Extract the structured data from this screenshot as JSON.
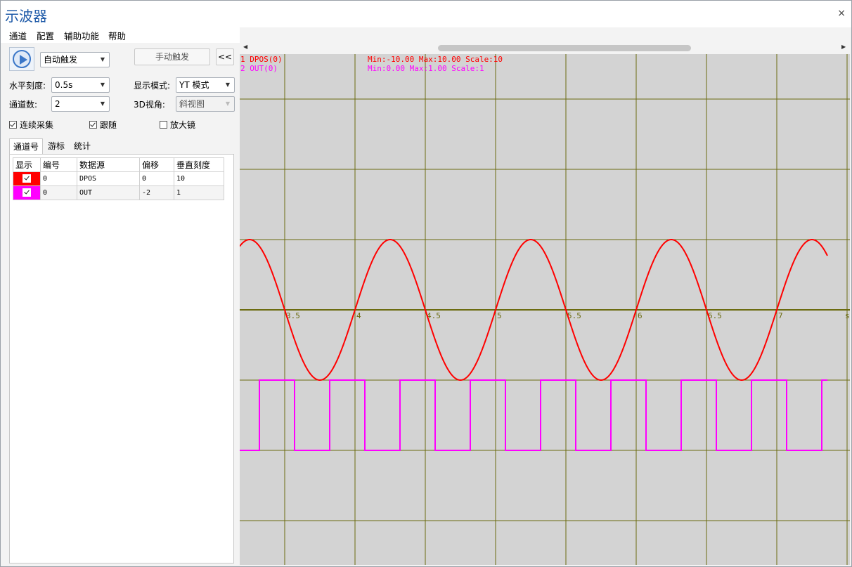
{
  "window": {
    "title": "示波器",
    "close_glyph": "×"
  },
  "menu": [
    "通道",
    "配置",
    "辅助功能",
    "帮助"
  ],
  "controls": {
    "trigger_mode": "自动触发",
    "manual_trigger": "手动触发",
    "collapse": "<<",
    "h_scale_label": "水平刻度:",
    "h_scale": "0.5s",
    "display_mode_label": "显示模式:",
    "display_mode": "YT 模式",
    "channels_label": "通道数:",
    "channels": "2",
    "view3d_label": "3D视角:",
    "view3d": "斜视图",
    "continuous": {
      "label": "连续采集",
      "checked": true
    },
    "follow": {
      "label": "跟随",
      "checked": true
    },
    "magnifier": {
      "label": "放大镜",
      "checked": false
    }
  },
  "tabs": [
    "通道号",
    "游标",
    "统计"
  ],
  "table": {
    "headers": [
      "显示",
      "编号",
      "数据源",
      "偏移",
      "垂直刻度"
    ],
    "rows": [
      {
        "color": "#ff0000",
        "checked": true,
        "num": "0",
        "source": "DPOS",
        "offset": "0",
        "scale": "10"
      },
      {
        "color": "#ff00ff",
        "checked": true,
        "num": "0",
        "source": "OUT",
        "offset": "-2",
        "scale": "1"
      }
    ]
  },
  "scope": {
    "background": "#d3d3d3",
    "grid_color": "#6b6b10",
    "info_lines": [
      {
        "label": "1 DPOS(0)",
        "stats": "Min:-10.00  Max:10.00  Scale:10",
        "color": "#ff0000"
      },
      {
        "label": "2 OUT(0)",
        "stats": "Min:0.00  Max:1.00  Scale:1",
        "color": "#ff00ff"
      }
    ],
    "x_tick_labels": [
      "3.5",
      "4",
      "4.5",
      "5",
      "5.5",
      "6",
      "6.5",
      "7"
    ],
    "x_unit": "s"
  },
  "chart_data": {
    "type": "line",
    "xlabel": "s",
    "xlim": [
      3.18,
      7.5
    ],
    "x_ticks": [
      3.5,
      4,
      4.5,
      5,
      5.5,
      6,
      6.5,
      7
    ],
    "series": [
      {
        "name": "DPOS",
        "color": "#ff0000",
        "kind": "sine",
        "amplitude": 10,
        "period": 1,
        "phase_zero_up_at": 3.0,
        "vertical_scale": 10,
        "offset": 0
      },
      {
        "name": "OUT",
        "color": "#ff00ff",
        "kind": "square",
        "low": 0,
        "high": 1,
        "period": 0.5,
        "rise_at": 3.32,
        "high_duration": 0.25,
        "vertical_scale": 1,
        "offset": -2
      }
    ]
  }
}
